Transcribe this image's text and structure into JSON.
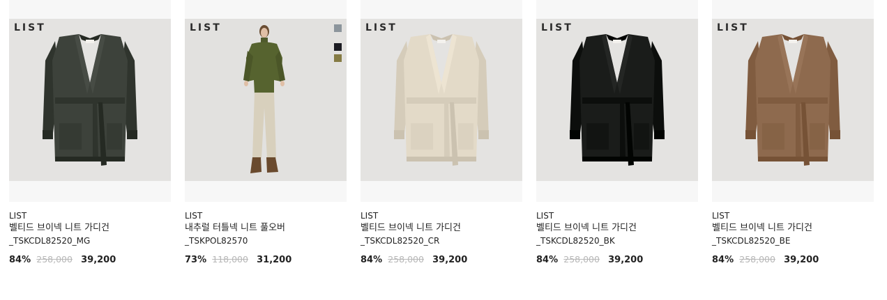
{
  "products": [
    {
      "logo": "LIST",
      "brand": "LIST",
      "name": "벨티드 브이넥 니트 가디건",
      "code": "_TSKCDL82520_MG",
      "discount": "84%",
      "original_price": "258,000",
      "sale_price": "39,200",
      "garment_color": "#3d423b",
      "image": "cardigan"
    },
    {
      "logo": "LIST",
      "brand": "LIST",
      "name": "내추럴 터틀넥 니트 풀오버",
      "code": "_TSKPOL82570",
      "discount": "73%",
      "original_price": "118,000",
      "sale_price": "31,200",
      "image": "model",
      "swatches": [
        "#8c959c",
        "#1c1c22",
        "#857b44"
      ]
    },
    {
      "logo": "LIST",
      "brand": "LIST",
      "name": "벨티드 브이넥 니트 가디건",
      "code": "_TSKCDL82520_CR",
      "discount": "84%",
      "original_price": "258,000",
      "sale_price": "39,200",
      "garment_color": "#e3dac8",
      "image": "cardigan"
    },
    {
      "logo": "LIST",
      "brand": "LIST",
      "name": "벨티드 브이넥 니트 가디건",
      "code": "_TSKCDL82520_BK",
      "discount": "84%",
      "original_price": "258,000",
      "sale_price": "39,200",
      "garment_color": "#1a1c1a",
      "image": "cardigan"
    },
    {
      "logo": "LIST",
      "brand": "LIST",
      "name": "벨티드 브이넥 니트 가디건",
      "code": "_TSKCDL82520_BE",
      "discount": "84%",
      "original_price": "258,000",
      "sale_price": "39,200",
      "garment_color": "#8e6a4e",
      "image": "cardigan"
    }
  ]
}
